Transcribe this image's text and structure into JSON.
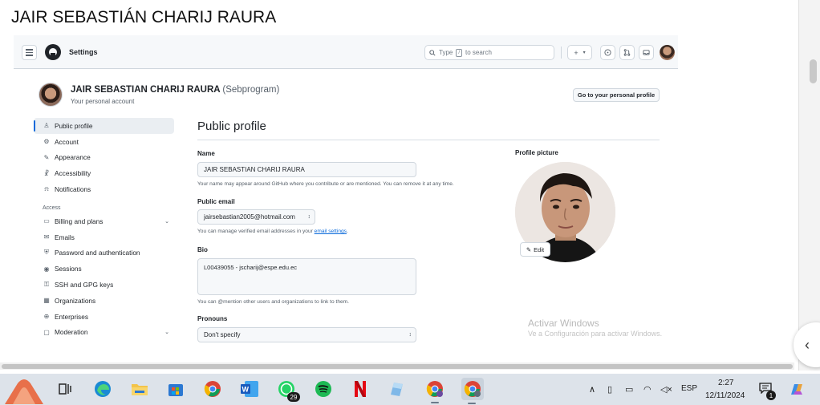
{
  "document": {
    "title": "JAIR SEBASTIÁN CHARIJ RAURA"
  },
  "github": {
    "header": {
      "breadcrumb": "Settings",
      "search_placeholder_prefix": "Type",
      "search_key": "/",
      "search_placeholder_suffix": "to search",
      "plus_label": "+",
      "caret_label": "▾"
    },
    "account": {
      "name": "JAIR SEBASTIAN CHARIJ RAURA",
      "login": "(Sebprogram)",
      "subtitle": "Your personal account",
      "go_to_profile": "Go to your personal profile"
    },
    "sidebar": {
      "items_top": [
        {
          "label": "Public profile",
          "icon": "person-icon"
        },
        {
          "label": "Account",
          "icon": "gear-icon"
        },
        {
          "label": "Appearance",
          "icon": "paintbrush-icon"
        },
        {
          "label": "Accessibility",
          "icon": "accessibility-icon"
        },
        {
          "label": "Notifications",
          "icon": "bell-icon"
        }
      ],
      "section_access": "Access",
      "items_access": [
        {
          "label": "Billing and plans",
          "icon": "credit-card-icon"
        },
        {
          "label": "Emails",
          "icon": "mail-icon"
        },
        {
          "label": "Password and authentication",
          "icon": "shield-lock-icon"
        },
        {
          "label": "Sessions",
          "icon": "broadcast-icon"
        },
        {
          "label": "SSH and GPG keys",
          "icon": "key-icon"
        },
        {
          "label": "Organizations",
          "icon": "organization-icon"
        },
        {
          "label": "Enterprises",
          "icon": "globe-icon"
        },
        {
          "label": "Moderation",
          "icon": "report-icon"
        }
      ]
    },
    "form": {
      "heading": "Public profile",
      "name_label": "Name",
      "name_value": "JAIR SEBASTIAN CHARIJ RAURA",
      "name_help": "Your name may appear around GitHub where you contribute or are mentioned. You can remove it at any time.",
      "email_label": "Public email",
      "email_value": "jairsebastian2005@hotmail.com",
      "email_help_prefix": "You can manage verified email addresses in your",
      "email_help_link": "email settings",
      "email_help_suffix": ".",
      "bio_label": "Bio",
      "bio_value": "L00439055 - jscharij@espe.edu.ec",
      "bio_help": "You can @mention other users and organizations to link to them.",
      "pronouns_label": "Pronouns",
      "pronouns_value": "Don't specify"
    },
    "profile_picture": {
      "label": "Profile picture",
      "edit_label": "Edit"
    }
  },
  "watermark": {
    "line1": "Activar Windows",
    "line2": "Ve a Configuración para activar Windows."
  },
  "taskbar": {
    "whatsapp_badge": "29",
    "language": "ESP",
    "time": "2:27",
    "date": "12/11/2024",
    "notification_count": "1"
  }
}
